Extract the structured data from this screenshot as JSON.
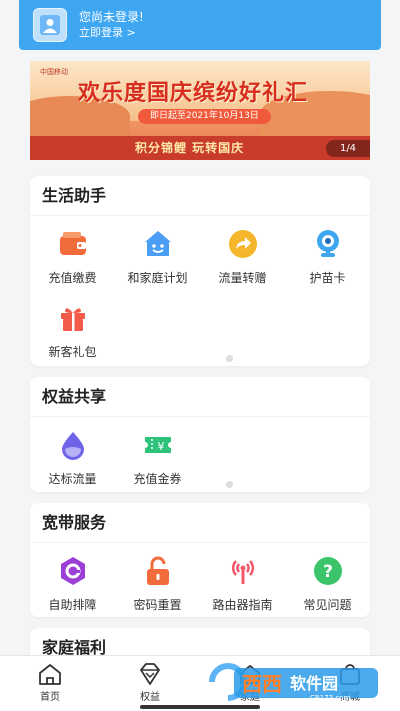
{
  "header": {
    "login_line1": "您尚未登录!",
    "login_line2": "立即登录 >"
  },
  "banner": {
    "brand": "中国移动",
    "title": "欢乐度国庆缤纷好礼汇",
    "date": "即日起至2021年10月13日",
    "slogan": "积分锦鲤 玩转国庆",
    "pager": "1/4"
  },
  "sections": {
    "life": {
      "title": "生活助手",
      "items": [
        {
          "label": "充值缴费",
          "icon": "wallet-icon",
          "color": "#f26b3a"
        },
        {
          "label": "和家庭计划",
          "icon": "house-face-icon",
          "color": "#4a9ff5"
        },
        {
          "label": "流量转赠",
          "icon": "share-arrow-icon",
          "color": "#f6b62b"
        },
        {
          "label": "护苗卡",
          "icon": "camera-icon",
          "color": "#3fa7f2"
        },
        {
          "label": "新客礼包",
          "icon": "gift-icon",
          "color": "#f25a4a"
        }
      ]
    },
    "rights": {
      "title": "权益共享",
      "items": [
        {
          "label": "达标流量",
          "icon": "water-drop-icon",
          "color": "#6f63e8"
        },
        {
          "label": "充值金券",
          "icon": "coupon-icon",
          "color": "#2fc27a"
        }
      ]
    },
    "broadband": {
      "title": "宽带服务",
      "items": [
        {
          "label": "自助排障",
          "icon": "hexagon-icon",
          "color": "#9b3fd6"
        },
        {
          "label": "密码重置",
          "icon": "lock-icon",
          "color": "#f26b3a"
        },
        {
          "label": "路由器指南",
          "icon": "router-antenna-icon",
          "color": "#f25a6a"
        },
        {
          "label": "常见问题",
          "icon": "question-icon",
          "color": "#3cc46a"
        }
      ]
    },
    "family": {
      "title": "家庭福利"
    }
  },
  "tabs": {
    "home": "首页",
    "rights": "权益",
    "family": "家庭",
    "mall": "商城"
  },
  "watermark": {
    "text1": "西西",
    "text2": "软件园",
    "url": "CR173.com"
  }
}
